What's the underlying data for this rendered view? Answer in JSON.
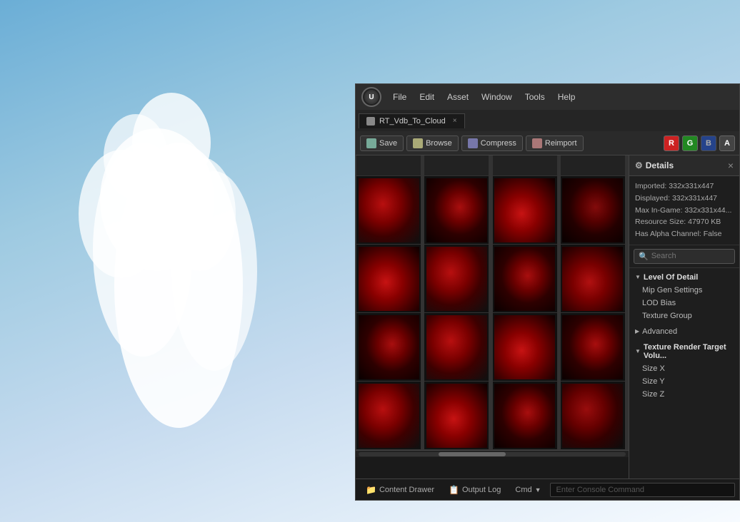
{
  "background": {
    "gradient_desc": "sky blue gradient with white cloud"
  },
  "menu": {
    "items": [
      "File",
      "Edit",
      "Asset",
      "Window",
      "Tools",
      "Help"
    ]
  },
  "tab": {
    "name": "RT_Vdb_To_Cloud",
    "close_char": "×"
  },
  "toolbar": {
    "save_label": "Save",
    "browse_label": "Browse",
    "compress_label": "Compress",
    "reimport_label": "Reimport",
    "channels": [
      "R",
      "G",
      "B",
      "A"
    ]
  },
  "details": {
    "title": "Details",
    "close_char": "×",
    "info": {
      "imported": "Imported: 332x331x447",
      "displayed": "Displayed: 332x331x447",
      "max_ingame": "Max In-Game: 332x331x44...",
      "resource_size": "Resource Size: 47970 KB",
      "has_alpha": "Has Alpha Channel: False"
    },
    "search_placeholder": "Search",
    "sections": [
      {
        "label": "Level Of Detail",
        "expanded": true,
        "items": [
          "Mip Gen Settings",
          "LOD Bias",
          "Texture Group"
        ]
      },
      {
        "label": "Advanced",
        "expanded": false,
        "items": []
      },
      {
        "label": "Texture Render Target Volu...",
        "expanded": true,
        "items": [
          "Size X",
          "Size Y",
          "Size Z"
        ]
      }
    ]
  },
  "statusbar": {
    "content_drawer_label": "Content Drawer",
    "output_log_label": "Output Log",
    "cmd_label": "Cmd",
    "console_placeholder": "Enter Console Command"
  },
  "texture_grid": {
    "rows": 4,
    "cols": 4
  }
}
